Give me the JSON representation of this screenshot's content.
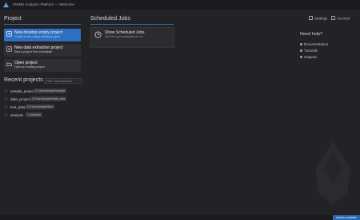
{
  "window": {
    "title": "KNIME Analytics Platform — Welcome"
  },
  "project": {
    "heading": "Project",
    "cards": [
      {
        "title": "New desktop empty project",
        "subtitle": "Create a new, empty desktop project",
        "icon": "new-project-icon",
        "selected": true
      },
      {
        "title": "New data extraction project",
        "subtitle": "Start a project from a template",
        "icon": "template-project-icon",
        "selected": false
      },
      {
        "title": "Open project",
        "subtitle": "Open an existing project",
        "icon": "open-folder-icon",
        "selected": false
      }
    ]
  },
  "recent": {
    "heading": "Recent projects",
    "filter_placeholder": "Filter recent projects",
    "items": [
      {
        "name": "sample_project",
        "tag": "C:/Users/project/sample"
      },
      {
        "name": "data_project",
        "tag": "C:/Users/project/data_sets"
      },
      {
        "name": "test_data",
        "tag": "C:/Users/project/test"
      },
      {
        "name": "analysis",
        "tag": "C:/analysis"
      }
    ]
  },
  "scheduled": {
    "heading": "Scheduled Jobs",
    "card": {
      "title": "Show Scheduled Jobs",
      "subtitle": "View the jobs scheduled to run"
    }
  },
  "top_links": {
    "settings": "Settings",
    "account": "Account"
  },
  "help": {
    "heading": "Need help?",
    "links": [
      "Documentation",
      "Tutorials",
      "Support"
    ]
  },
  "status": {
    "update": "Update available"
  },
  "colors": {
    "accent": "#2d6fc0",
    "background": "#232326",
    "card": "#2f2f33"
  }
}
